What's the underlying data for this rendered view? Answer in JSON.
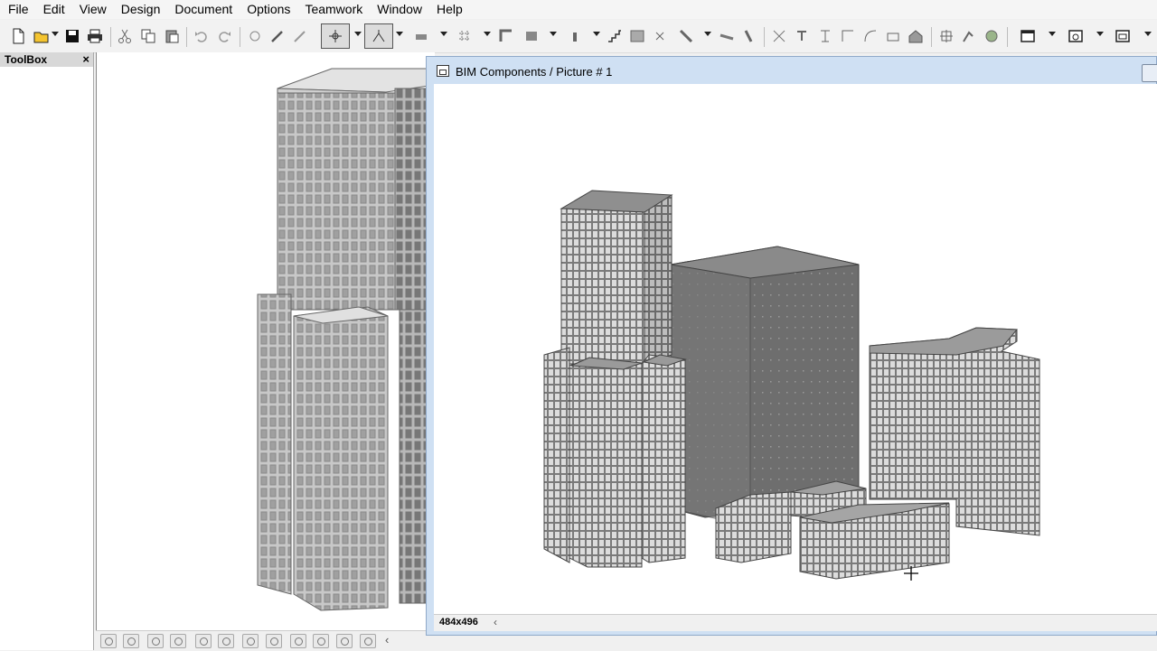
{
  "menu": [
    "File",
    "Edit",
    "View",
    "Design",
    "Document",
    "Options",
    "Teamwork",
    "Window",
    "Help"
  ],
  "toolbox": {
    "title": "ToolBox",
    "close": "×"
  },
  "picture_window": {
    "title": "BIM Components / Picture # 1",
    "size": "484x496",
    "scroll_left": "‹"
  },
  "main_scroll_left": "‹",
  "icons": {
    "new": "new-document-icon",
    "open": "open-icon",
    "save": "save-icon",
    "print": "print-icon",
    "cut": "cut-icon",
    "copy": "copy-icon",
    "paste": "paste-icon",
    "undo": "undo-icon",
    "redo": "redo-icon"
  }
}
